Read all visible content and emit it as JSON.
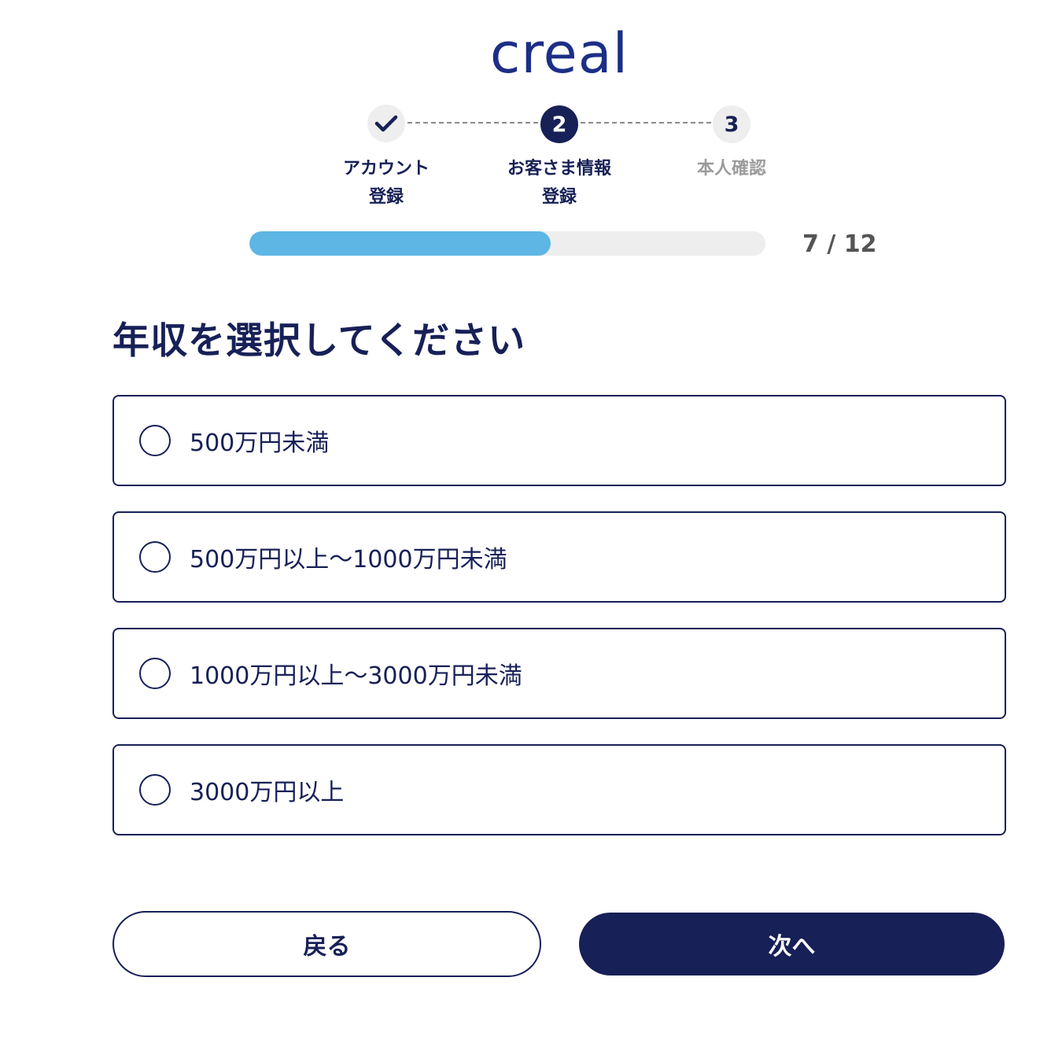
{
  "brand": {
    "logo_text": "creal",
    "color": "#1c2f86"
  },
  "stepper": {
    "steps": [
      {
        "status": "done",
        "icon": "check-icon",
        "label_line1": "アカウント",
        "label_line2": "登録"
      },
      {
        "status": "active",
        "number": "2",
        "label_line1": "お客さま情報",
        "label_line2": "登録"
      },
      {
        "status": "todo",
        "number": "3",
        "label_line1": "本人確認",
        "label_line2": ""
      }
    ]
  },
  "progress": {
    "current": 7,
    "total": 12,
    "text": "7 / 12",
    "fill_color": "#5db6e3"
  },
  "question": {
    "title": "年収を選択してください"
  },
  "options": [
    {
      "label": "500万円未満",
      "selected": false
    },
    {
      "label": "500万円以上〜1000万円未満",
      "selected": false
    },
    {
      "label": "1000万円以上〜3000万円未満",
      "selected": false
    },
    {
      "label": "3000万円以上",
      "selected": false
    }
  ],
  "buttons": {
    "back_label": "戻る",
    "next_label": "次へ"
  },
  "colors": {
    "primary": "#172057",
    "track": "#eeeeee",
    "muted": "#9b9b9b"
  }
}
